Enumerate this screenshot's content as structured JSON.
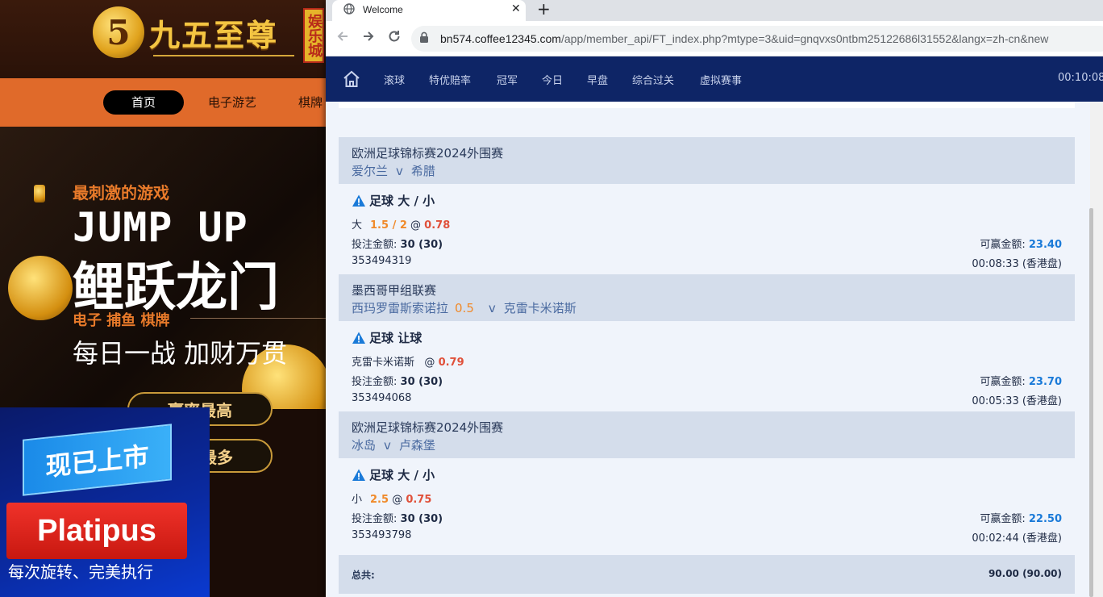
{
  "background_site": {
    "logo_digit": "5",
    "logo_text": "九五至尊",
    "logo_badge": "娱乐城",
    "nav": [
      "首页",
      "电子游艺",
      "棋牌"
    ],
    "banner": {
      "tagline": "最刺激的游戏",
      "title_en": "JUMP UP",
      "title_cn": "鲤跃龙门",
      "sub1": "电子  捕鱼  棋牌",
      "sub2": "每日一战  加财万贯",
      "btn1": "赢率最高",
      "btn2": "最多"
    },
    "promo": {
      "ribbon": "现已上市",
      "brand": "Platipus",
      "slogan": "每次旋转、完美执行"
    }
  },
  "browser": {
    "tab_title": "Welcome",
    "url_host": "bn574.coffee12345.com",
    "url_path": "/app/member_api/FT_index.php?mtype=3&uid=gnqvxs0ntbm25122686l31552&langx=zh-cn&new"
  },
  "sitenav": {
    "items": [
      "滚球",
      "特优赔率",
      "冠军",
      "今日",
      "早盘",
      "综合过关",
      "虚拟赛事"
    ],
    "time": "00:10:08"
  },
  "bets": [
    {
      "league": "欧洲足球锦标赛2024外围赛",
      "home": "爱尔兰",
      "vs": "v",
      "away": "希腊",
      "bet_type": "足球 大 / 小",
      "pick": "大",
      "line": "1.5 / 2",
      "at": "@",
      "odds": "0.78",
      "stake_label": "投注金额:",
      "stake": "30 (30)",
      "win_label": "可赢金额:",
      "win": "23.40",
      "ticket": "353494319",
      "time": "00:08:33 (香港盘)"
    },
    {
      "league": "墨西哥甲组联赛",
      "home": "西玛罗雷斯索诺拉",
      "handicap": "0.5",
      "vs": "v",
      "away": "克雷卡米诺斯",
      "bet_type": "足球 让球",
      "pick": "克雷卡米诺斯",
      "line": "",
      "at": "@",
      "odds": "0.79",
      "stake_label": "投注金额:",
      "stake": "30 (30)",
      "win_label": "可赢金额:",
      "win": "23.70",
      "ticket": "353494068",
      "time": "00:05:33 (香港盘)"
    },
    {
      "league": "欧洲足球锦标赛2024外围赛",
      "home": "冰岛",
      "vs": "v",
      "away": "卢森堡",
      "bet_type": "足球 大 / 小",
      "pick": "小",
      "line": "2.5",
      "at": "@",
      "odds": "0.75",
      "stake_label": "投注金额:",
      "stake": "30 (30)",
      "win_label": "可赢金额:",
      "win": "22.50",
      "ticket": "353493798",
      "time": "00:02:44 (香港盘)"
    }
  ],
  "total": {
    "label": "总共:",
    "value": "90.00 (90.00)"
  },
  "colors": {
    "nav_bg": "#0e2566",
    "accent_orange": "#f08a2a",
    "odds_red": "#e0503a",
    "win_blue": "#1a7ad8",
    "row_head_bg": "#d4ddeb"
  }
}
